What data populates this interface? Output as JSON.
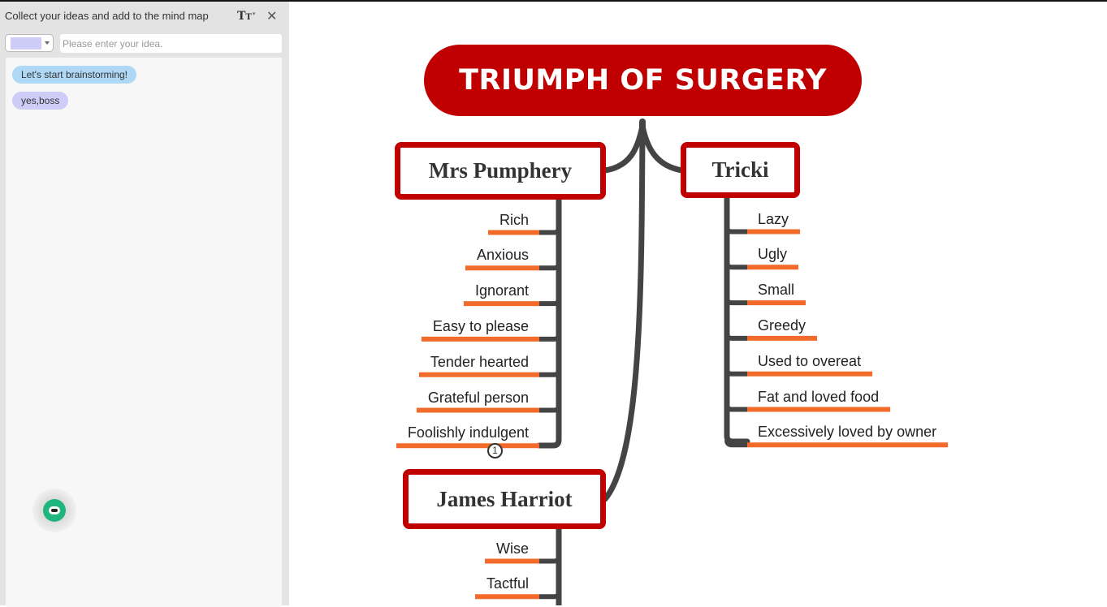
{
  "sidebar": {
    "title": "Collect your ideas and add to the mind map",
    "font_button": {
      "big": "T",
      "small": "T",
      "caret": "▾"
    },
    "close_icon": "✕",
    "color_picker": {
      "selected_color": "#cdcdf7"
    },
    "idea_input": {
      "value": "",
      "placeholder": "Please enter your idea."
    },
    "ideas": [
      {
        "label": "Let's start brainstorming!",
        "color": "#aed8f5"
      },
      {
        "label": "yes,boss",
        "color": "#cdcdf7"
      }
    ],
    "assistant_icon": "robot-icon"
  },
  "mindmap": {
    "colors": {
      "root": "#c00000",
      "topic_border": "#c00000",
      "connector": "#444444",
      "leaf_underline": "#f26b2a"
    },
    "root": {
      "label": "TRIUMPH OF SURGERY"
    },
    "topics": [
      {
        "label": "Mrs Pumphery",
        "children": [
          "Rich",
          "Anxious",
          "Ignorant",
          "Easy to please",
          "Tender hearted",
          "Grateful person",
          "Foolishly indulgent"
        ],
        "collapsed_badge": "1"
      },
      {
        "label": "Tricki",
        "children": [
          "Lazy",
          "Ugly",
          "Small",
          "Greedy",
          "Used to overeat",
          "Fat and loved food",
          "Excessively loved by owner"
        ]
      },
      {
        "label": "James Harriot",
        "children": [
          "Wise",
          "Tactful"
        ]
      }
    ]
  }
}
